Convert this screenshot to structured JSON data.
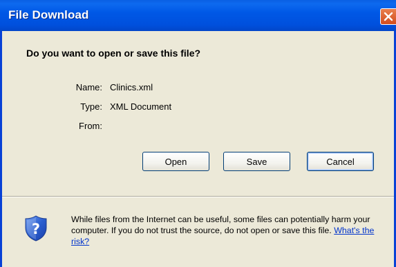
{
  "window": {
    "title": "File Download"
  },
  "dialog": {
    "question": "Do you want to open or save this file?",
    "fields": [
      {
        "label": "Name:",
        "value": "Clinics.xml"
      },
      {
        "label": "Type:",
        "value": "XML Document"
      },
      {
        "label": "From:",
        "value": ""
      }
    ],
    "buttons": {
      "open": "Open",
      "save": "Save",
      "cancel": "Cancel"
    },
    "warning_text": "While files from the Internet can be useful, some files can potentially harm your computer. If you do not trust the source, do not open or save this file.",
    "risk_link": "What's the risk?"
  },
  "colors": {
    "titlebar": "#0058e6",
    "dialog_bg": "#ece9d8",
    "close_button": "#e05a28",
    "link": "#0033cc"
  },
  "icons": {
    "close": "close-icon",
    "shield": "security-shield-question-icon"
  }
}
